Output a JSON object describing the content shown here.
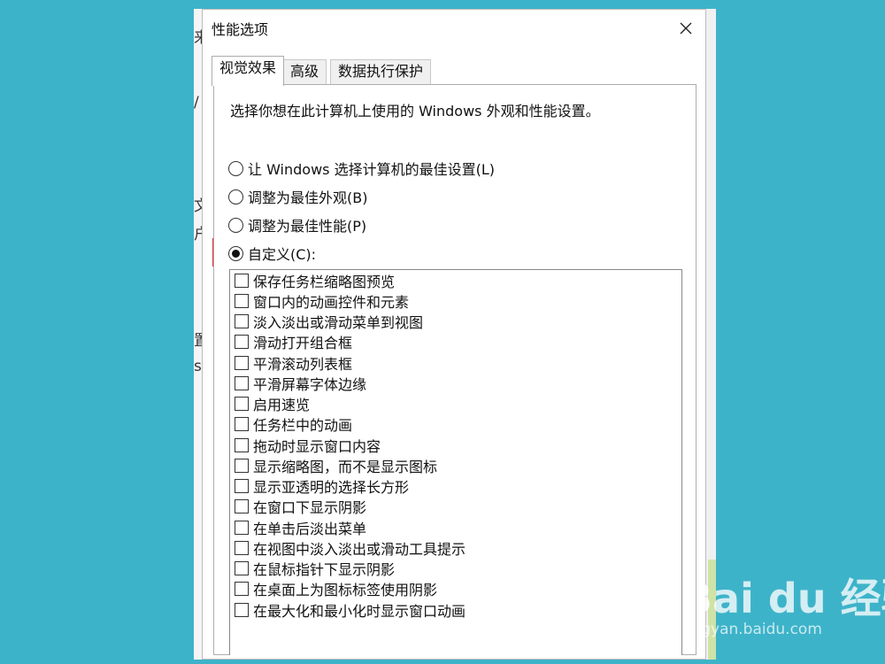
{
  "background": {
    "left_fragments": [
      "来",
      "/",
      "文",
      "户",
      "置",
      "s"
    ]
  },
  "dialog": {
    "title": "性能选项",
    "close_glyph": "✕"
  },
  "tabs": [
    {
      "label": "视觉效果",
      "active": true
    },
    {
      "label": "高级",
      "active": false
    },
    {
      "label": "数据执行保护",
      "active": false
    }
  ],
  "panel": {
    "description": "选择你想在此计算机上使用的 Windows 外观和性能设置。",
    "radio_options": [
      {
        "label": "让 Windows 选择计算机的最佳设置(L)",
        "checked": false
      },
      {
        "label": "调整为最佳外观(B)",
        "checked": false
      },
      {
        "label": "调整为最佳性能(P)",
        "checked": false
      },
      {
        "label": "自定义(C):",
        "checked": true
      }
    ],
    "visual_effects": [
      {
        "label": "保存任务栏缩略图预览",
        "checked": false
      },
      {
        "label": "窗口内的动画控件和元素",
        "checked": false
      },
      {
        "label": "淡入淡出或滑动菜单到视图",
        "checked": false
      },
      {
        "label": "滑动打开组合框",
        "checked": false
      },
      {
        "label": "平滑滚动列表框",
        "checked": false
      },
      {
        "label": "平滑屏幕字体边缘",
        "checked": false
      },
      {
        "label": "启用速览",
        "checked": false
      },
      {
        "label": "任务栏中的动画",
        "checked": false
      },
      {
        "label": "拖动时显示窗口内容",
        "checked": false
      },
      {
        "label": "显示缩略图，而不是显示图标",
        "checked": false
      },
      {
        "label": "显示亚透明的选择长方形",
        "checked": false
      },
      {
        "label": "在窗口下显示阴影",
        "checked": false
      },
      {
        "label": "在单击后淡出菜单",
        "checked": false
      },
      {
        "label": "在视图中淡入淡出或滑动工具提示",
        "checked": false
      },
      {
        "label": "在鼠标指针下显示阴影",
        "checked": false
      },
      {
        "label": "在桌面上为图标标签使用阴影",
        "checked": false
      },
      {
        "label": "在最大化和最小化时显示窗口动画",
        "checked": false
      }
    ]
  },
  "annotation": {
    "color": "#e8323c"
  },
  "watermark": {
    "logo_text": "Bai du 经验",
    "url": "jingyan.baidu.com"
  },
  "colors": {
    "background": "#3db3c9",
    "dialog": "#ffffff",
    "annotation_red": "#e8323c"
  }
}
